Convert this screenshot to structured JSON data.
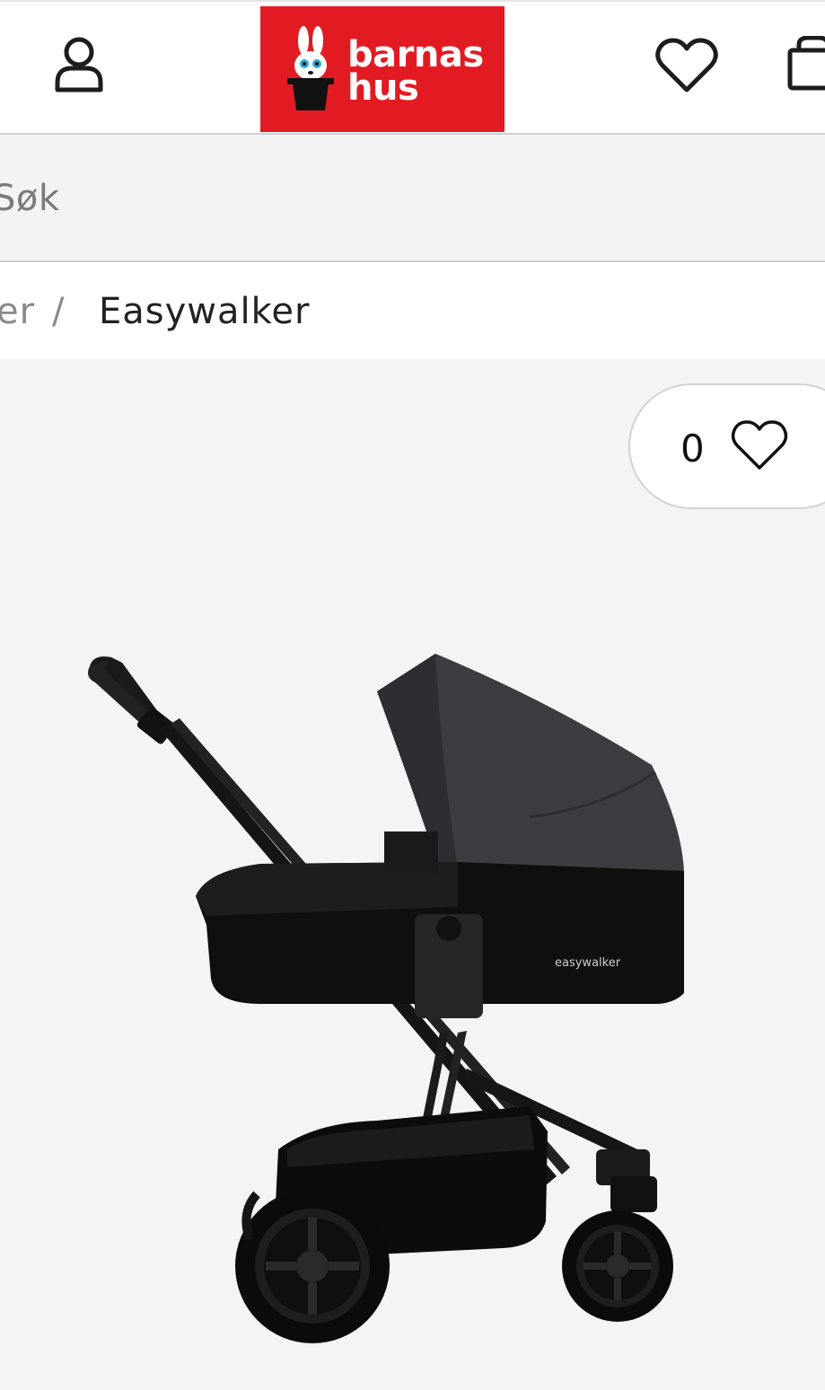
{
  "header": {
    "logo_line1": "barnas",
    "logo_line2": "hus",
    "brand_color": "#e21b23",
    "icons": [
      "user-icon",
      "heart-icon",
      "shopping-bag-icon"
    ]
  },
  "search": {
    "placeholder": "Søk"
  },
  "breadcrumb": {
    "previous": "er",
    "separator": "/",
    "current": "Easywalker"
  },
  "product": {
    "favorite_count": "0",
    "image_brand_text": "easywalker"
  }
}
